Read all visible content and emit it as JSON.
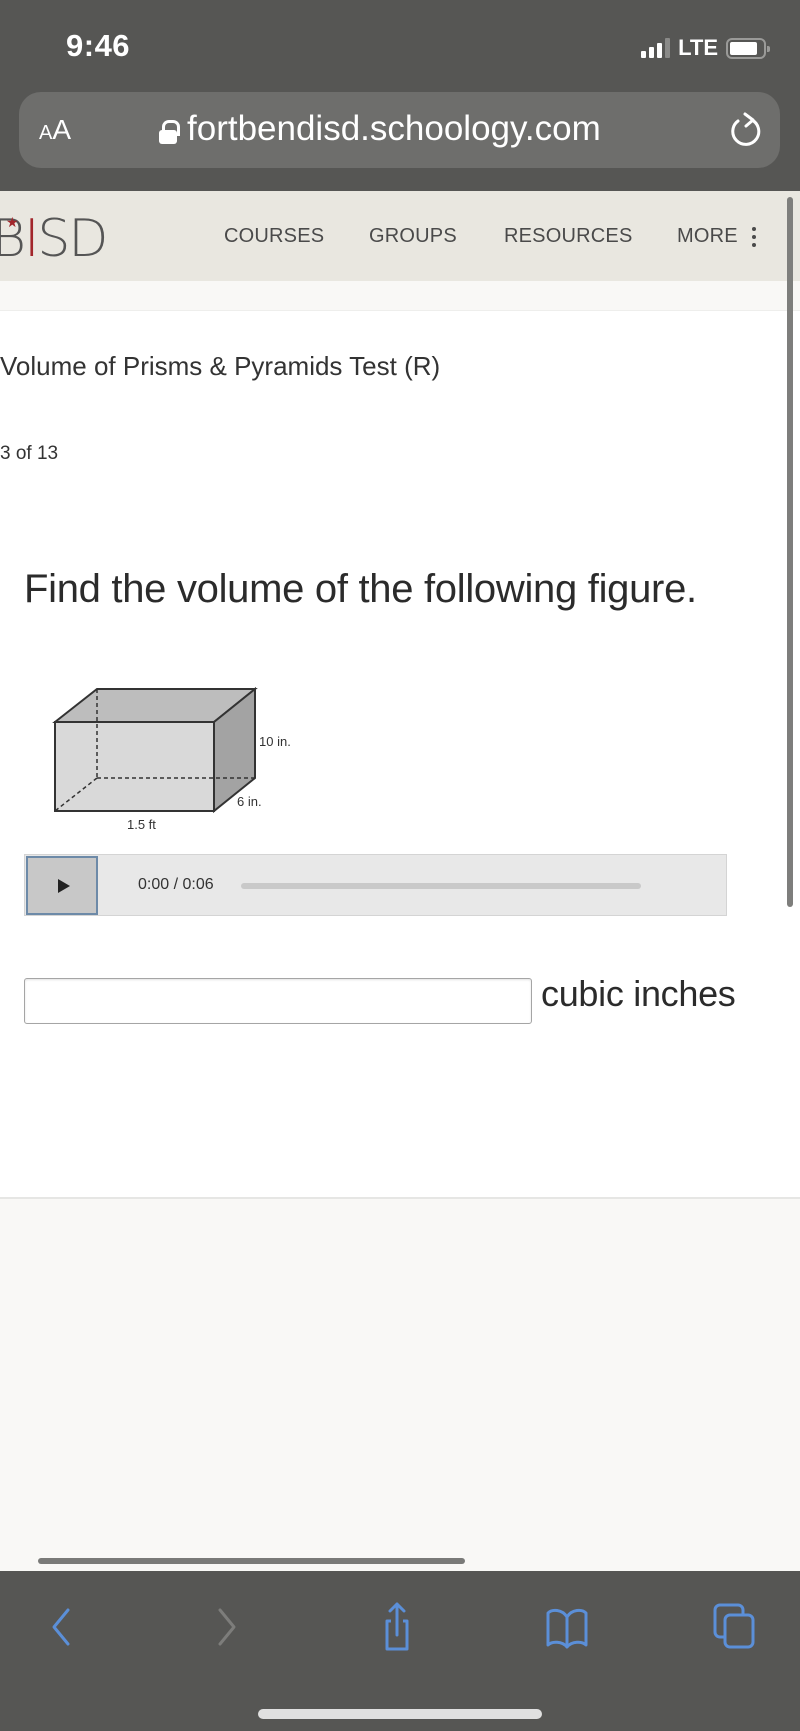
{
  "status_bar": {
    "time": "9:46",
    "network": "LTE",
    "signal_bars_active": 3,
    "signal_bars_total": 4,
    "battery_percent": 85
  },
  "browser": {
    "text_size_label_small": "A",
    "text_size_label_large": "A",
    "url": "fortbendisd.schoology.com",
    "icons": {
      "lock": "lock-icon",
      "reload": "reload-icon",
      "back": "chevron-left-icon",
      "forward": "chevron-right-icon",
      "share": "share-icon",
      "bookmarks": "book-icon",
      "tabs": "tabs-icon"
    },
    "toolbar_accent": "#5b8fd8"
  },
  "site": {
    "logo_prefix": "B",
    "logo_i": "I",
    "logo_suffix": "SD",
    "logo_accent": "#a2262b",
    "nav": [
      {
        "label": "COURSES"
      },
      {
        "label": "GROUPS"
      },
      {
        "label": "RESOURCES"
      },
      {
        "label": "MORE"
      }
    ]
  },
  "assessment": {
    "title": "Volume of Prisms & Pyramids Test (R)",
    "question_counter": "3 of 13",
    "prompt": "Find the volume of the following figure.",
    "figure": {
      "shape": "rectangular prism",
      "length_label": "1.5 ft",
      "height_label": "10 in.",
      "depth_label": "6 in."
    },
    "audio": {
      "current_time": "0:00",
      "duration": "0:06",
      "time_display": "0:00 / 0:06",
      "progress": 0
    },
    "answer": {
      "value": "",
      "placeholder": "",
      "unit": "cubic inches"
    }
  }
}
